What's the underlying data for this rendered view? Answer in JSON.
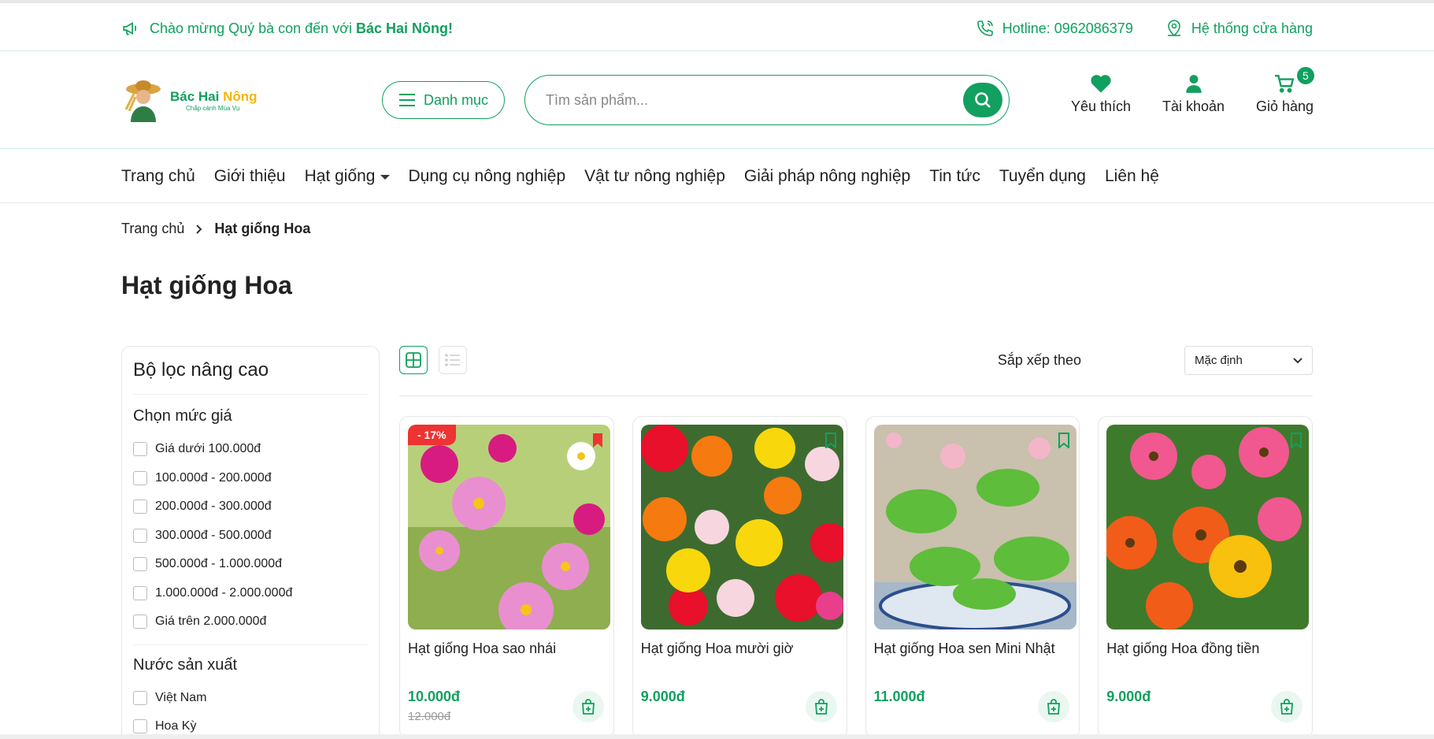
{
  "topbar": {
    "welcome_prefix": "Chào mừng Quý bà con đến với",
    "welcome_brand": "Bác Hai Nông!",
    "hotline": "Hotline: 0962086379",
    "stores": "Hệ thống cửa hàng"
  },
  "header": {
    "logo_name_1": "Bác Hai",
    "logo_name_2": "Nông",
    "logo_slogan": "Chắp cánh Mùa Vụ",
    "category_label": "Danh mục",
    "search_placeholder": "Tìm sản phẩm...",
    "wishlist": "Yêu thích",
    "account": "Tài khoản",
    "cart": "Giỏ hàng",
    "cart_count": "5"
  },
  "nav": [
    "Trang chủ",
    "Giới thiệu",
    "Hạt giống",
    "Dụng cụ nông nghiệp",
    "Vật tư nông nghiệp",
    "Giải pháp nông nghiệp",
    "Tin tức",
    "Tuyển dụng",
    "Liên hệ"
  ],
  "breadcrumb": {
    "home": "Trang chủ",
    "current": "Hạt giống Hoa"
  },
  "page_title": "Hạt giống Hoa",
  "filter": {
    "title": "Bộ lọc nâng cao",
    "price_title": "Chọn mức giá",
    "prices": [
      "Giá dưới 100.000đ",
      "100.000đ - 200.000đ",
      "200.000đ - 300.000đ",
      "300.000đ - 500.000đ",
      "500.000đ - 1.000.000đ",
      "1.000.000đ - 2.000.000đ",
      "Giá trên 2.000.000đ"
    ],
    "origin_title": "Nước sản xuất",
    "origins": [
      "Việt Nam",
      "Hoa Kỳ"
    ]
  },
  "toolbar": {
    "sort_label": "Sắp xếp theo",
    "sort_value": "Mặc định"
  },
  "products": [
    {
      "name": "Hạt giống Hoa sao nhái",
      "price": "10.000đ",
      "old_price": "12.000đ",
      "discount": "- 17%"
    },
    {
      "name": "Hạt giống Hoa mười giờ",
      "price": "9.000đ"
    },
    {
      "name": "Hạt giống Hoa sen Mini Nhật",
      "price": "11.000đ"
    },
    {
      "name": "Hạt giống Hoa đồng tiền",
      "price": "9.000đ"
    }
  ],
  "colors": {
    "accent": "#11a05f",
    "yellow": "#f5b50a",
    "sale": "#ee3333"
  }
}
